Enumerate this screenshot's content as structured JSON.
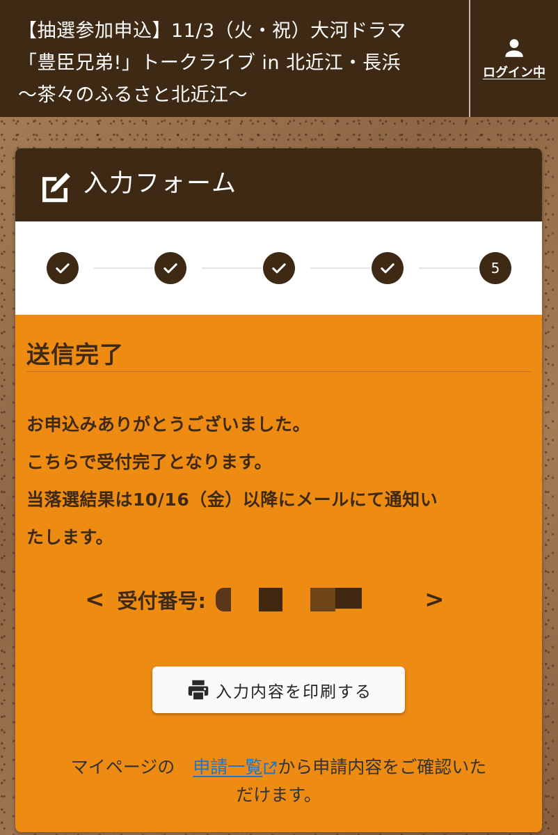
{
  "header": {
    "title_line1": "【抽選参加申込】11/3（火・祝）大河ドラマ",
    "title_line2": "「豊臣兄弟!」トークライブ in 北近江・長浜",
    "title_line3": "〜茶々のふるさと北近江〜",
    "login_label": "ログイン中",
    "login_icon": "person-icon"
  },
  "card": {
    "title": "入力フォーム",
    "title_icon": "edit-icon"
  },
  "steps": {
    "completed_icon": "check-icon",
    "items": [
      "check",
      "check",
      "check",
      "check",
      "5"
    ],
    "current_label": "5"
  },
  "result": {
    "title": "送信完了",
    "line1": "お申込みありがとうございました。",
    "line2": "こちらで受付完了となります。",
    "line3": "当落選結果は10/16（金）以降にメールにて通知い",
    "line4": "たします。",
    "receipt_prev": "<",
    "receipt_label": "受付番号:",
    "receipt_next": ">"
  },
  "print_button": {
    "label": "入力内容を印刷する",
    "icon": "printer-icon"
  },
  "footer": {
    "prefix": "マイページの",
    "link_text": "申請一覧",
    "link_icon": "external-link-icon",
    "suffix_line1": "から申請内容をご確認いた",
    "suffix_line2": "だけます。"
  },
  "colors": {
    "header_bg": "#3e2a14",
    "card_bg": "#ed8b13",
    "text_dark": "#3e2a14",
    "link": "#1e75c9"
  }
}
